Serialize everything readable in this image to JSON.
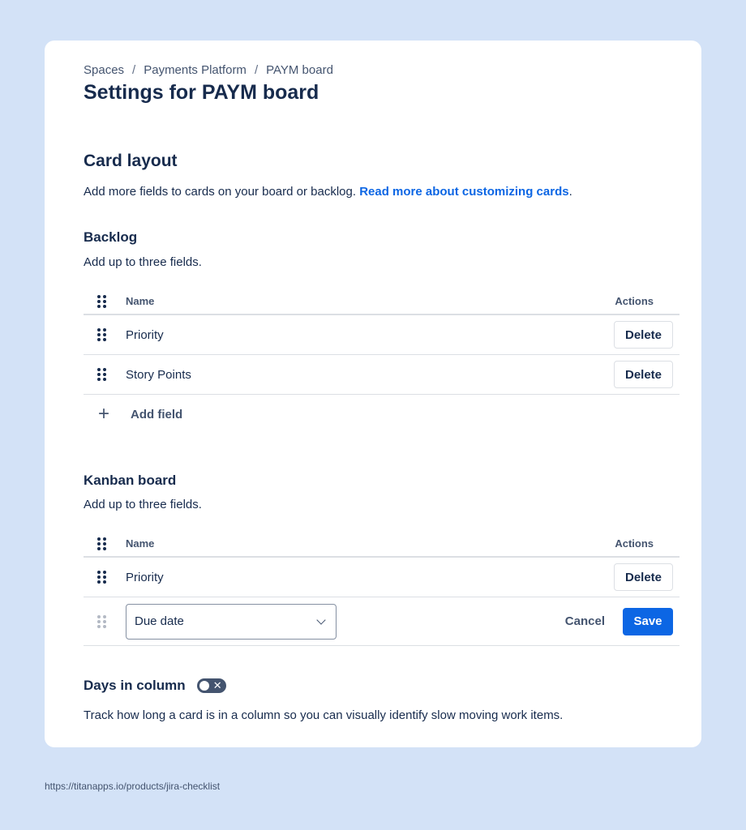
{
  "breadcrumb": [
    "Spaces",
    "Payments Platform",
    "PAYM board"
  ],
  "page_title": "Settings for PAYM board",
  "card_layout": {
    "title": "Card layout",
    "description": "Add more fields to cards on your board or backlog.",
    "link_text": "Read more about customizing cards",
    "link_suffix": "."
  },
  "backlog": {
    "title": "Backlog",
    "hint": "Add up to three fields.",
    "col_name": "Name",
    "col_actions": "Actions",
    "rows": [
      {
        "name": "Priority",
        "action": "Delete"
      },
      {
        "name": "Story Points",
        "action": "Delete"
      }
    ],
    "add_label": "Add field"
  },
  "kanban": {
    "title": "Kanban board",
    "hint": "Add up to three fields.",
    "col_name": "Name",
    "col_actions": "Actions",
    "rows": [
      {
        "name": "Priority",
        "action": "Delete"
      }
    ],
    "edit": {
      "select_value": "Due date",
      "cancel_label": "Cancel",
      "save_label": "Save"
    }
  },
  "days_in_column": {
    "title": "Days in column",
    "toggle_on": false,
    "description": "Track how long a card is in a column so you can visually identify slow moving work items."
  },
  "footer_url": "https://titanapps.io/products/jira-checklist",
  "colors": {
    "background": "#d3e2f7",
    "primary": "#0c66e4",
    "text": "#172b4d"
  }
}
